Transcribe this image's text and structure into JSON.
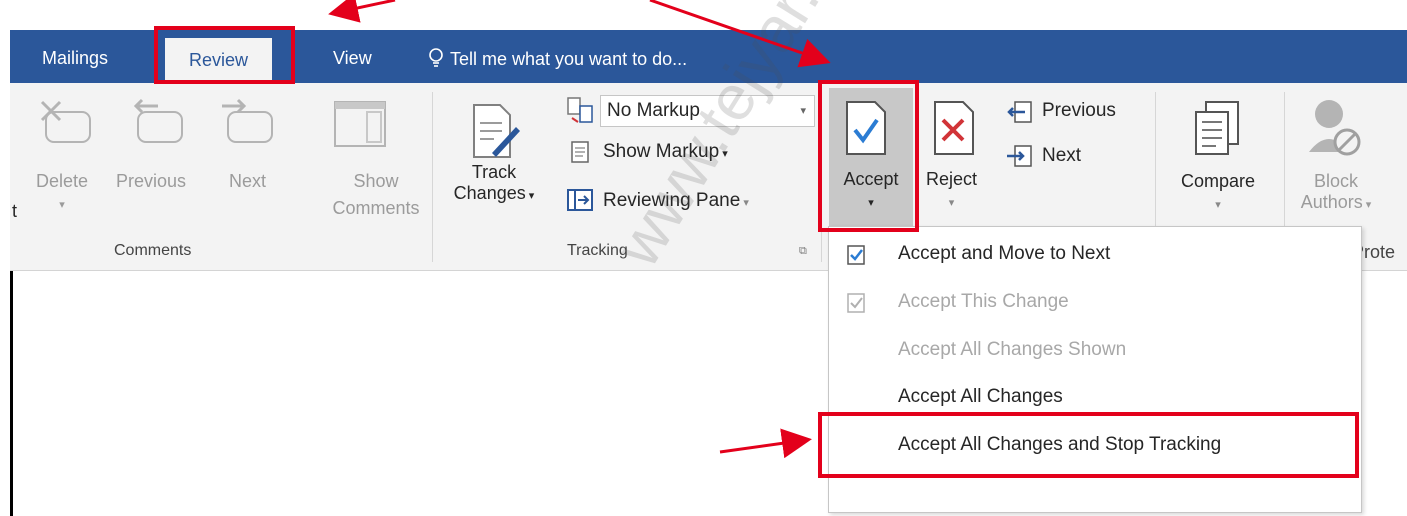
{
  "tabs": {
    "mailings": "Mailings",
    "review": "Review",
    "view": "View",
    "tell_me": "Tell me what you want to do..."
  },
  "comments_group": {
    "delete_label": "Delete",
    "previous_label": "Previous",
    "next_label": "Next",
    "show_label_1": "Show",
    "show_label_2": "Comments",
    "group_label": "Comments"
  },
  "tracking_group": {
    "track_label_1": "Track",
    "track_label_2": "Changes",
    "markup_select": "No Markup",
    "show_markup": "Show Markup",
    "reviewing_pane": "Reviewing Pane",
    "group_label": "Tracking"
  },
  "changes_group": {
    "accept_label": "Accept",
    "reject_label": "Reject",
    "previous_label": "Previous",
    "next_label": "Next"
  },
  "compare_group": {
    "compare_label": "Compare"
  },
  "protect_group": {
    "block_label_1": "Block",
    "block_label_2": "Authors",
    "group_label": "Prote"
  },
  "accept_menu": {
    "items": [
      {
        "label": "Accept and Move to Next",
        "enabled": true
      },
      {
        "label": "Accept This Change",
        "enabled": false
      },
      {
        "label": "Accept All Changes Shown",
        "enabled": false
      },
      {
        "label": "Accept All Changes",
        "enabled": true
      },
      {
        "label": "Accept All Changes and Stop Tracking",
        "enabled": true
      }
    ]
  },
  "watermark": "www.tejyar.com",
  "colors": {
    "ribbon_blue": "#2b579a",
    "highlight_red": "#e3001b",
    "check_blue": "#2b7cd3",
    "reject_red": "#d13438"
  }
}
